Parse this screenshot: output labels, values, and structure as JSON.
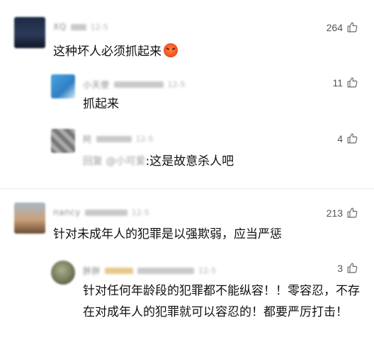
{
  "comments": [
    {
      "user": "XQ",
      "meta_time": "12-5",
      "likes": "264",
      "text": "这种坏人必须抓起来",
      "emoji": "angry-face",
      "replies": [
        {
          "user": "小天使",
          "meta_time": "12-5",
          "likes": "11",
          "text": "抓起来"
        },
        {
          "user": "阿",
          "meta_time": "12-5",
          "likes": "4",
          "quote_user": "回复 @小可爱",
          "text": ":这是故意杀人吧"
        }
      ]
    },
    {
      "user": "nancy",
      "meta_time": "12-5",
      "likes": "213",
      "text": "针对未成年人的犯罪是以强欺弱，应当严惩",
      "replies": [
        {
          "user": "胖胖",
          "meta_time": "12-5",
          "likes": "3",
          "text": "针对任何年龄段的犯罪都不能纵容！！零容忍，不存在对成年人的犯罪就可以容忍的！都要严厉打击！"
        }
      ]
    }
  ]
}
